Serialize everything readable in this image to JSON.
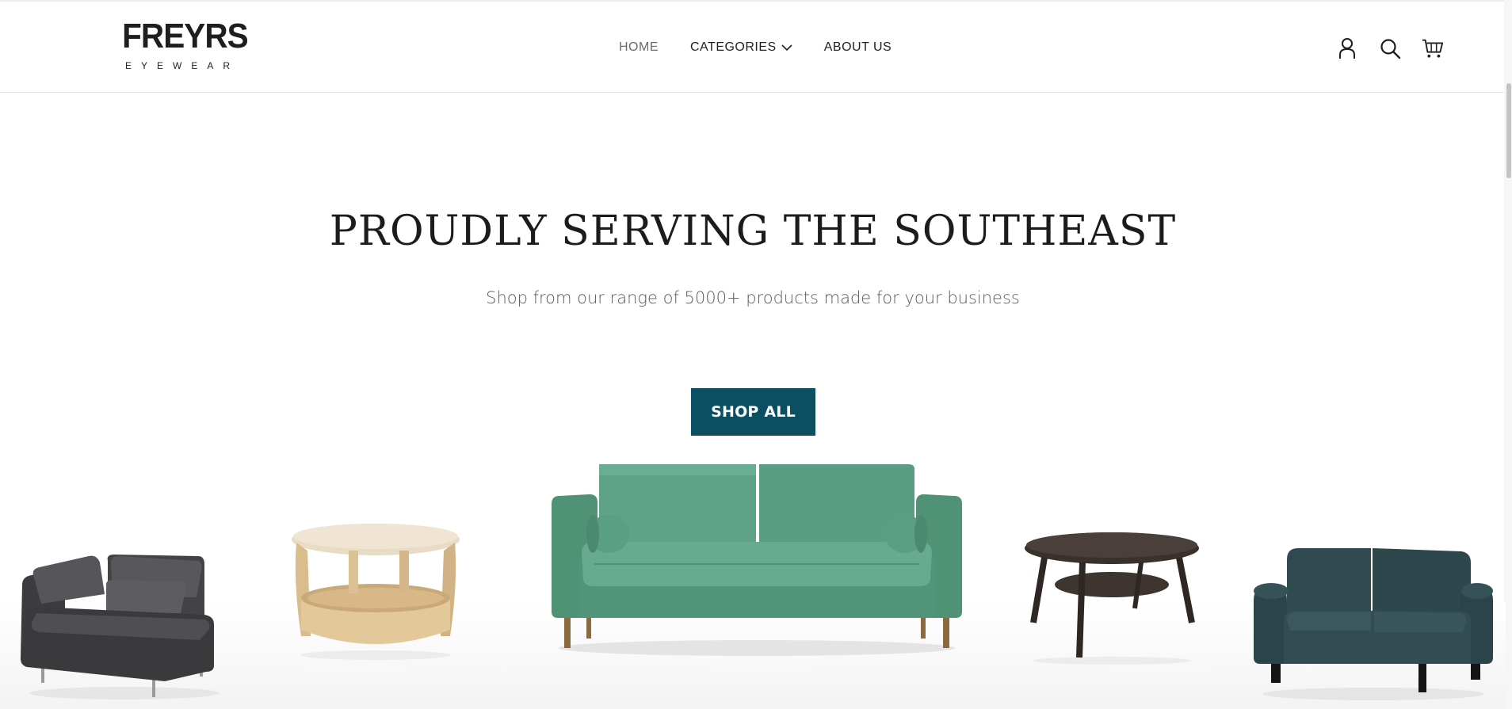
{
  "brand": {
    "name": "FREYRS",
    "tagline": "EYEWEAR"
  },
  "nav": {
    "items": [
      {
        "label": "HOME",
        "active": true
      },
      {
        "label": "CATEGORIES",
        "has_dropdown": true
      },
      {
        "label": "ABOUT US"
      }
    ]
  },
  "header_icons": [
    "account-icon",
    "search-icon",
    "cart-icon"
  ],
  "hero": {
    "title": "PROUDLY SERVING THE SOUTHEAST",
    "subtitle": "Shop from our range of 5000+ products made for your business",
    "cta_label": "SHOP ALL",
    "cta_color": "#0c4f63"
  },
  "products": [
    {
      "name": "grey-corner-armchair",
      "color": "#4a4a4d"
    },
    {
      "name": "round-wooden-side-table",
      "color": "#e9d6b4"
    },
    {
      "name": "green-sofa",
      "color": "#5fa287"
    },
    {
      "name": "dark-round-coffee-table",
      "color": "#3e3430"
    },
    {
      "name": "teal-loveseat",
      "color": "#2f4a4f"
    }
  ]
}
